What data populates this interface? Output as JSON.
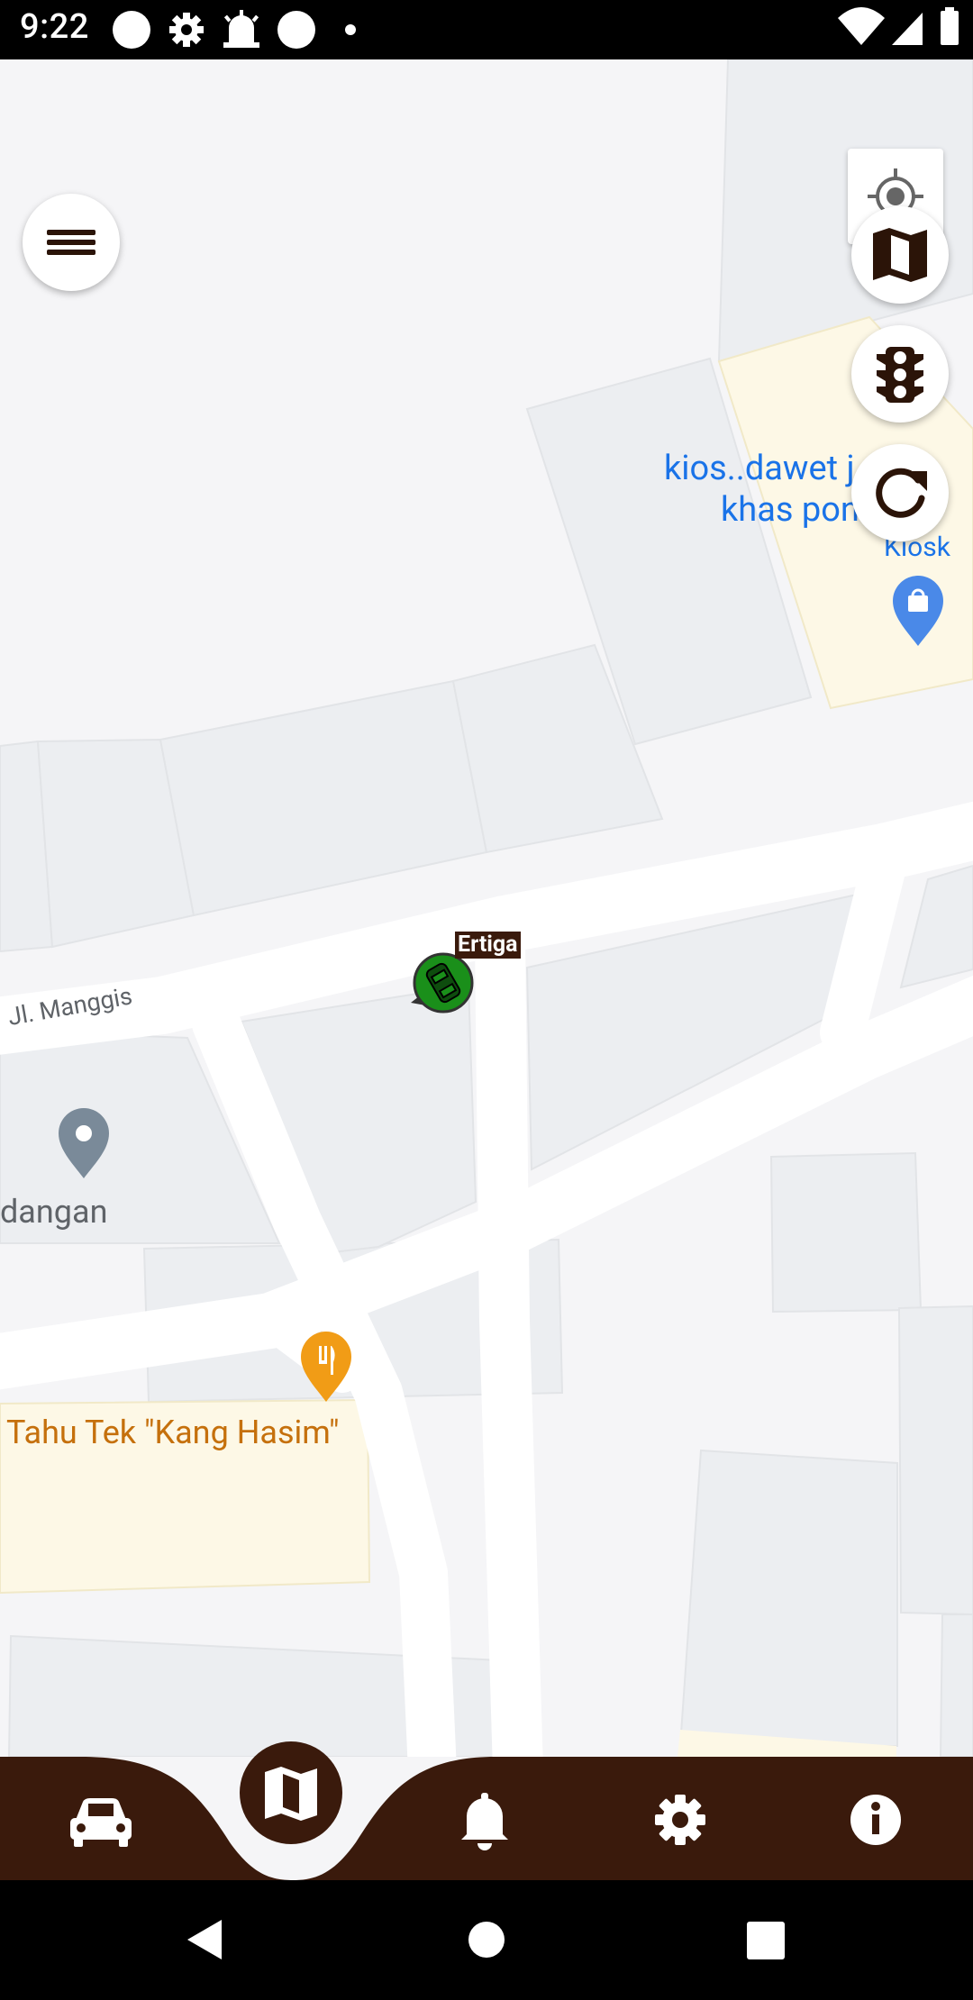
{
  "status_bar": {
    "time": "9:22",
    "left_icons": [
      "circle-notification-icon",
      "settings-notification-icon",
      "alarm-notification-icon",
      "circle-notification-icon",
      "dot-icon"
    ],
    "right_icons": [
      "wifi-icon",
      "cell-signal-icon",
      "battery-icon"
    ]
  },
  "map": {
    "street_label": "Jl. Manggis",
    "vehicle_label": "Ertiga",
    "vehicle_color": "#1a8f1a",
    "poi_kiosk_title_line1": "kios..dawet j",
    "poi_kiosk_title_line2": "khas pon",
    "poi_kiosk_category": "Kiosk",
    "poi_kiosk_color": "#1a73e8",
    "poi_left_partial": "dangan",
    "poi_restaurant": "Tahu Tek \"Kang Hasim\"",
    "poi_restaurant_color": "#c5700c"
  },
  "controls": {
    "my_location": "my-location-icon",
    "map_type": "map-icon",
    "traffic": "traffic-light-icon",
    "refresh": "refresh-icon",
    "menu": "hamburger-menu-icon"
  },
  "bottom_nav": {
    "items": [
      "car-icon",
      "map-icon",
      "bell-icon",
      "gear-icon",
      "info-icon"
    ],
    "active": "map-icon",
    "bar_color": "#3a1a0c"
  },
  "system_nav": [
    "back-icon",
    "home-icon",
    "recents-icon"
  ]
}
